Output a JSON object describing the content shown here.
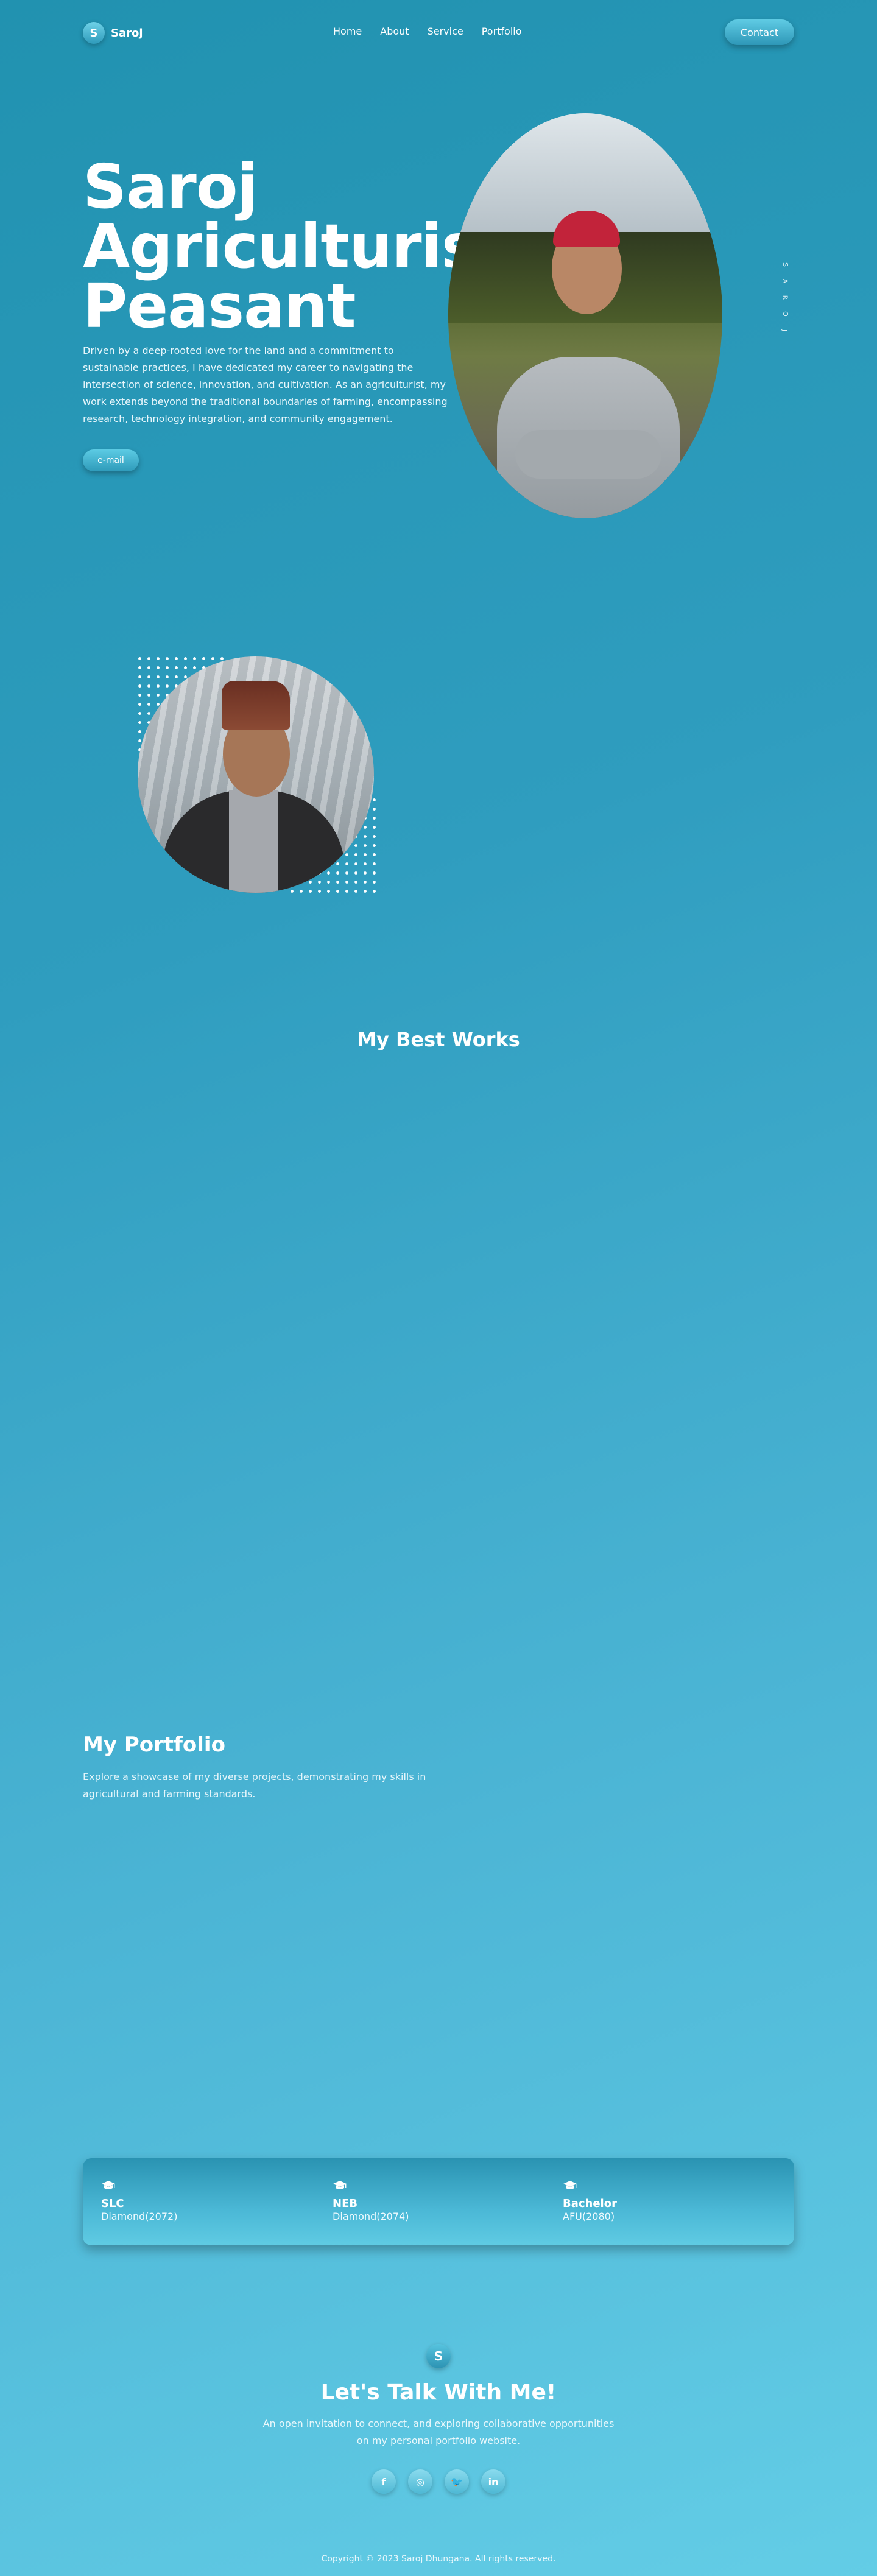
{
  "nav": {
    "brand_initial": "S",
    "brand_name": "Saroj",
    "links": [
      "Home",
      "About",
      "Service",
      "Portfolio"
    ],
    "contact_label": "Contact"
  },
  "hero": {
    "title_lines": [
      "Saroj",
      "Agriculturist",
      "Peasant"
    ],
    "description": "Driven by a deep-rooted love for the land and a commitment to sustainable practices, I have dedicated my career to navigating the intersection of science, innovation, and cultivation. As an agriculturist, my work extends beyond the traditional boundaries of farming, encompassing research, technology integration, and community engagement.",
    "email_label": "e-mail",
    "side_letters": [
      "S",
      "A",
      "R",
      "O",
      "J"
    ]
  },
  "works": {
    "title": "My Best Works"
  },
  "portfolio": {
    "title": "My Portfolio",
    "description": "Explore a showcase of my diverse projects, demonstrating my skills in agricultural and farming standards."
  },
  "education": [
    {
      "icon": "graduation-cap-icon",
      "level": "SLC",
      "detail": "Diamond(2072)"
    },
    {
      "icon": "graduation-cap-icon",
      "level": "NEB",
      "detail": "Diamond(2074)"
    },
    {
      "icon": "graduation-cap-icon",
      "level": "Bachelor",
      "detail": "AFU(2080)"
    }
  ],
  "contact": {
    "badge_initial": "S",
    "title": "Let's Talk With Me!",
    "description": "An open invitation to connect, and exploring collaborative opportunities on my personal portfolio website.",
    "socials": [
      {
        "icon": "facebook-icon",
        "glyph": "f"
      },
      {
        "icon": "instagram-icon",
        "glyph": "◎"
      },
      {
        "icon": "twitter-icon",
        "glyph": "🐦"
      },
      {
        "icon": "linkedin-icon",
        "glyph": "in"
      }
    ]
  },
  "footer": {
    "copyright": "Copyright © 2023 Saroj Dhungana. All rights reserved."
  },
  "colors": {
    "background_start": "#2192b0",
    "background_end": "#63cde6",
    "button_gradient_top": "#5fcbe4",
    "button_gradient_bottom": "#2e97b7"
  }
}
